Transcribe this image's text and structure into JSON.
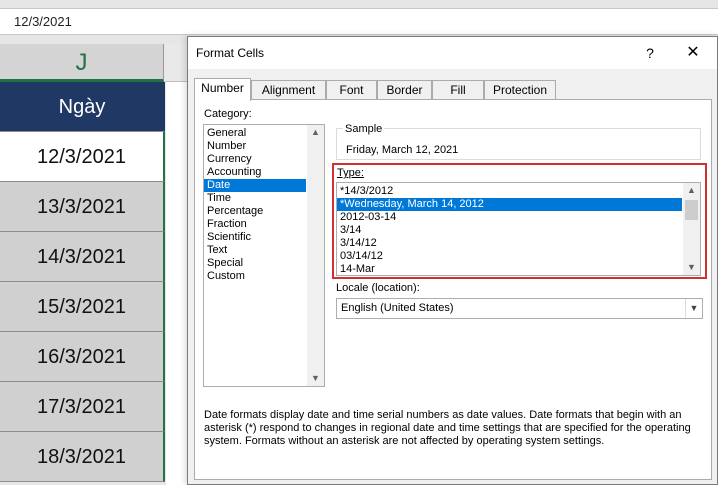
{
  "excel": {
    "formula_value": "12/3/2021",
    "column_letter": "J",
    "header_cell": "Ngày",
    "cells": [
      "12/3/2021",
      "13/3/2021",
      "14/3/2021",
      "15/3/2021",
      "16/3/2021",
      "17/3/2021",
      "18/3/2021"
    ]
  },
  "dialog": {
    "title": "Format Cells",
    "help_glyph": "?",
    "close_glyph": "✕",
    "tabs": [
      "Number",
      "Alignment",
      "Font",
      "Border",
      "Fill",
      "Protection"
    ],
    "active_tab": "Number",
    "category_label": "Category:",
    "categories": [
      "General",
      "Number",
      "Currency",
      "Accounting",
      "Date",
      "Time",
      "Percentage",
      "Fraction",
      "Scientific",
      "Text",
      "Special",
      "Custom"
    ],
    "selected_category": "Date",
    "sample_label": "Sample",
    "sample_value": "Friday, March 12, 2021",
    "type_label": "Type:",
    "types": [
      "*14/3/2012",
      "*Wednesday, March 14, 2012",
      "2012-03-14",
      "3/14",
      "3/14/12",
      "03/14/12",
      "14-Mar"
    ],
    "selected_type": "*Wednesday, March 14, 2012",
    "locale_label": "Locale (location):",
    "locale_value": "English (United States)",
    "description": "Date formats display date and time serial numbers as date values.  Date formats that begin with an asterisk (*) respond to changes in regional date and time settings that are specified for the operating system. Formats without an asterisk are not affected by operating system settings."
  },
  "colors": {
    "accent_green": "#217346",
    "header_navy": "#203864",
    "selection_blue": "#0078d7",
    "highlight_red": "#d32f2f"
  }
}
